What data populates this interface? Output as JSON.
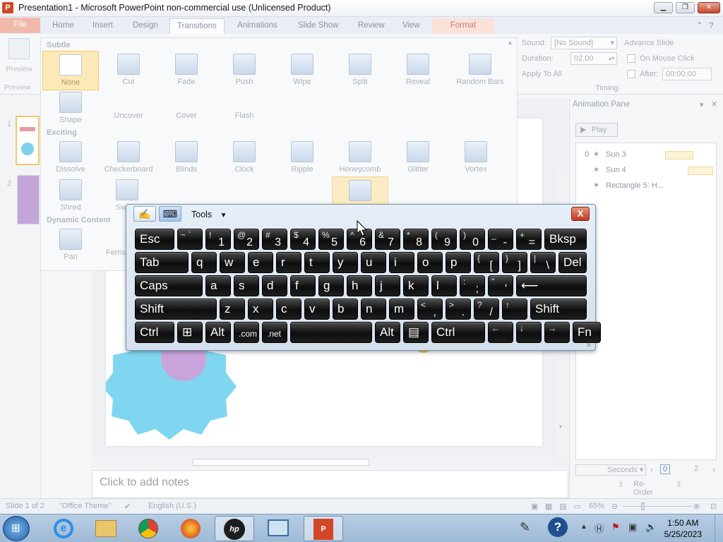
{
  "window": {
    "title": "Presentation1 - Microsoft PowerPoint non-commercial use (Unlicensed Product)",
    "icon_letter": "P",
    "controls": [
      "minimize-icon",
      "maximize-icon",
      "close-icon"
    ]
  },
  "ribbon_tabs": [
    {
      "label": "File"
    },
    {
      "label": "Home"
    },
    {
      "label": "Insert"
    },
    {
      "label": "Design"
    },
    {
      "label": "Transitions"
    },
    {
      "label": "Animations"
    },
    {
      "label": "Slide Show"
    },
    {
      "label": "Review"
    },
    {
      "label": "View"
    },
    {
      "label": "Format"
    }
  ],
  "ribbon": {
    "preview_label": "Preview",
    "preview_group": "Preview",
    "timing": {
      "sound_label": "Sound:",
      "sound_value": "[No Sound]",
      "duration_label": "Duration:",
      "duration_value": "02.00",
      "apply_all": "Apply To All",
      "advance_label": "Advance Slide",
      "on_click": "On Mouse Click",
      "after_label": "After:",
      "after_value": "00:00.00",
      "group": "Timing"
    }
  },
  "gallery": {
    "subtle_header": "Subtle",
    "exciting_header": "Exciting",
    "dynamic_header": "Dynamic Content",
    "subtle": [
      "None",
      "Cut",
      "Fade",
      "Push",
      "Wipe",
      "Split",
      "Reveal",
      "Random Bars",
      "Shape",
      "Uncover",
      "Cover",
      "Flash"
    ],
    "exciting": [
      "Dissolve",
      "Checkerboard",
      "Blinds",
      "Clock",
      "Ripple",
      "Honeycomb",
      "Glitter",
      "Vortex",
      "Shred",
      "Sw",
      "Ferris"
    ],
    "dynamic": [
      "Pan"
    ]
  },
  "thumbnails": {
    "numbers": [
      "1",
      "2"
    ]
  },
  "notes_placeholder": "Click to add notes",
  "animation_pane": {
    "title": "Animation Pane",
    "play_label": "Play",
    "items": [
      {
        "index": "0",
        "name": "Sun 3"
      },
      {
        "index": "",
        "name": "Sun 4"
      },
      {
        "index": "",
        "name": "Rectangle 5: H..."
      }
    ],
    "seconds_label": "Seconds",
    "timeline_start": "0",
    "timeline_end": "2",
    "reorder_label": "Re-Order"
  },
  "status_bar": {
    "slide": "Slide 1 of 2",
    "theme": "\"Office Theme\"",
    "language": "English (U.S.)",
    "zoom": "65%"
  },
  "osk": {
    "tools_label": "Tools",
    "close_label": "X",
    "rows": [
      [
        {
          "main": "Esc",
          "w": 56
        },
        {
          "main": "",
          "sup": "~ `",
          "w": 36
        },
        {
          "main": "1",
          "sup": "!",
          "w": 36
        },
        {
          "main": "2",
          "sup": "@",
          "w": 36
        },
        {
          "main": "3",
          "sup": "#",
          "w": 36
        },
        {
          "main": "4",
          "sup": "$",
          "w": 36
        },
        {
          "main": "5",
          "sup": "%",
          "w": 36
        },
        {
          "main": "6",
          "sup": "^",
          "w": 36
        },
        {
          "main": "7",
          "sup": "&",
          "w": 36
        },
        {
          "main": "8",
          "sup": "*",
          "w": 36
        },
        {
          "main": "9",
          "sup": "(",
          "w": 36
        },
        {
          "main": "0",
          "sup": ")",
          "w": 36
        },
        {
          "main": "-",
          "sup": "_",
          "w": 36
        },
        {
          "main": "=",
          "sup": "+",
          "w": 36
        },
        {
          "main": "Bksp",
          "w": 60
        }
      ],
      [
        {
          "main": "Tab",
          "w": 76
        },
        {
          "main": "q",
          "w": 36
        },
        {
          "main": "w",
          "w": 36
        },
        {
          "main": "e",
          "w": 36
        },
        {
          "main": "r",
          "w": 36
        },
        {
          "main": "t",
          "w": 36
        },
        {
          "main": "y",
          "w": 36
        },
        {
          "main": "u",
          "w": 36
        },
        {
          "main": "i",
          "w": 36
        },
        {
          "main": "o",
          "w": 36
        },
        {
          "main": "p",
          "w": 36
        },
        {
          "main": "[",
          "sup": "{",
          "w": 36
        },
        {
          "main": "]",
          "sup": "}",
          "w": 36
        },
        {
          "main": "\\",
          "sup": "|",
          "w": 36
        },
        {
          "main": "Del",
          "w": 40
        }
      ],
      [
        {
          "main": "Caps",
          "w": 96
        },
        {
          "main": "a",
          "w": 36
        },
        {
          "main": "s",
          "w": 36
        },
        {
          "main": "d",
          "w": 36
        },
        {
          "main": "f",
          "w": 36
        },
        {
          "main": "g",
          "w": 36
        },
        {
          "main": "h",
          "w": 36
        },
        {
          "main": "j",
          "w": 36
        },
        {
          "main": "k",
          "w": 36
        },
        {
          "main": "l",
          "w": 36
        },
        {
          "main": ";",
          "sup": ":",
          "w": 36
        },
        {
          "main": "'",
          "sup": "\"",
          "w": 36
        },
        {
          "main": "⟵",
          "w": 100
        }
      ],
      [
        {
          "main": "Shift",
          "w": 116
        },
        {
          "main": "z",
          "w": 36
        },
        {
          "main": "x",
          "w": 36
        },
        {
          "main": "c",
          "w": 36
        },
        {
          "main": "v",
          "w": 36
        },
        {
          "main": "b",
          "w": 36
        },
        {
          "main": "n",
          "w": 36
        },
        {
          "main": "m",
          "w": 36
        },
        {
          "main": ",",
          "sup": "<",
          "w": 36
        },
        {
          "main": ".",
          "sup": ">",
          "w": 36
        },
        {
          "main": "/",
          "sup": "?",
          "w": 36
        },
        {
          "main": "",
          "sup": "↑",
          "w": 36
        },
        {
          "main": "Shift",
          "w": 80
        }
      ],
      [
        {
          "main": "Ctrl",
          "w": 56
        },
        {
          "main": "⊞",
          "w": 36
        },
        {
          "main": "Alt",
          "w": 36
        },
        {
          "main": ".com",
          "w": 36,
          "small": true
        },
        {
          "main": ".net",
          "w": 36,
          "small": true
        },
        {
          "main": "",
          "w": 116
        },
        {
          "main": "Alt",
          "w": 36
        },
        {
          "main": "▤",
          "w": 36
        },
        {
          "main": "Ctrl",
          "w": 76
        },
        {
          "main": "",
          "sup": "←",
          "w": 36
        },
        {
          "main": "",
          "sup": "↓",
          "w": 36
        },
        {
          "main": "",
          "sup": "→",
          "w": 36
        },
        {
          "main": "Fn",
          "w": 40
        }
      ]
    ]
  },
  "taskbar": {
    "items": [
      "start-orb",
      "internet-explorer",
      "file-explorer",
      "chrome",
      "firefox",
      "hp-app",
      "remote-desktop",
      "powerpoint"
    ],
    "time": "1:50 AM",
    "date": "5/25/2023"
  }
}
